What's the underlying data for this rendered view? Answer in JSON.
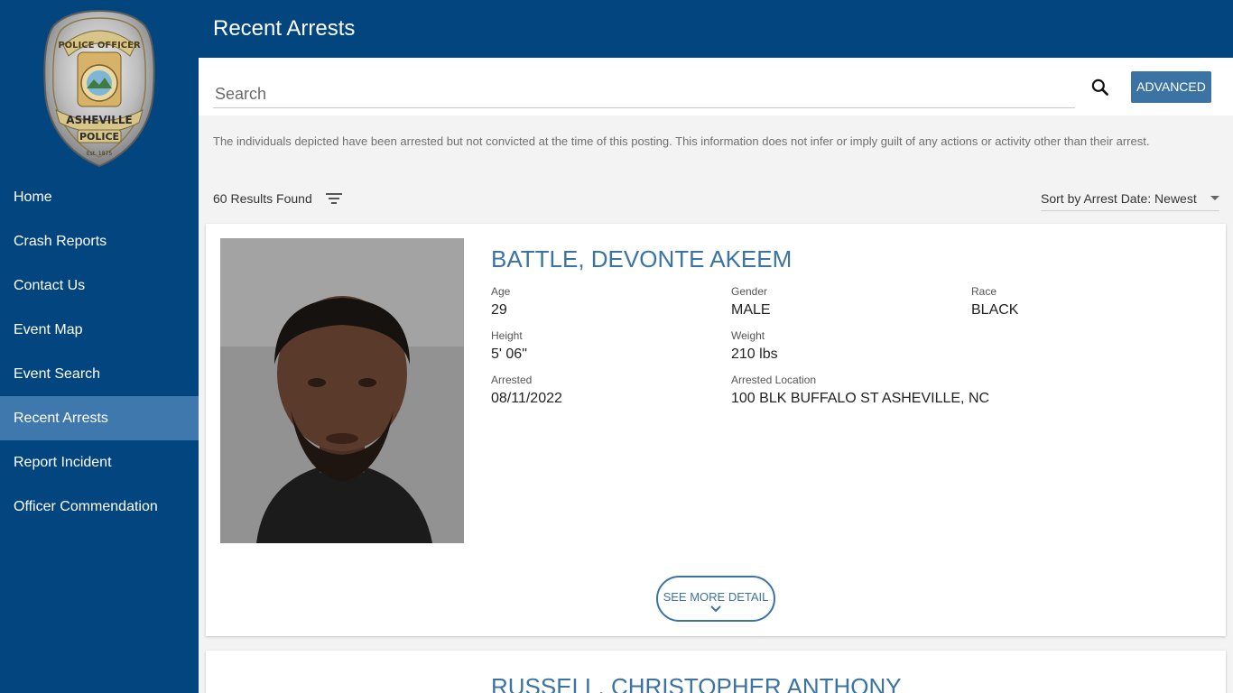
{
  "sidebar": {
    "badge": {
      "top_text": "POLICE OFFICER",
      "city": "ASHEVILLE",
      "dept": "POLICE",
      "est": "Est. 1875"
    },
    "items": [
      {
        "label": "Home"
      },
      {
        "label": "Crash Reports"
      },
      {
        "label": "Contact Us"
      },
      {
        "label": "Event Map"
      },
      {
        "label": "Event Search"
      },
      {
        "label": "Recent Arrests",
        "active": true
      },
      {
        "label": "Report Incident"
      },
      {
        "label": "Officer Commendation"
      }
    ]
  },
  "header": {
    "title": "Recent Arrests"
  },
  "search": {
    "placeholder": "Search",
    "advanced_label": "ADVANCED"
  },
  "disclaimer": "The individuals depicted have been arrested but not convicted at the time of this posting. This information does not infer or imply guilt of any actions or activity other than their arrest.",
  "results": {
    "count_text": "60 Results Found",
    "sort_label": "Sort by Arrest Date: Newest"
  },
  "arrests": [
    {
      "name": "BATTLE, DEVONTE AKEEM",
      "age_label": "Age",
      "age": "29",
      "gender_label": "Gender",
      "gender": "MALE",
      "race_label": "Race",
      "race": "BLACK",
      "height_label": "Height",
      "height": "5' 06\"",
      "weight_label": "Weight",
      "weight": "210 lbs",
      "arrested_label": "Arrested",
      "arrested": "08/11/2022",
      "location_label": "Arrested Location",
      "location": "100 BLK BUFFALO ST ASHEVILLE, NC",
      "see_more": "SEE MORE DETAIL"
    },
    {
      "name": "RUSSELL, CHRISTOPHER ANTHONY"
    }
  ],
  "colors": {
    "nav_bg": "#02457f",
    "accent": "#3b73a5",
    "nav_active": "#3f78ad"
  }
}
